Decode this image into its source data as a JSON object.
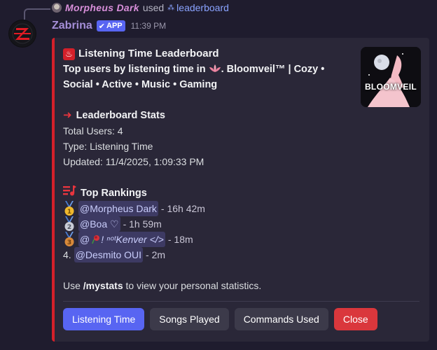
{
  "reply": {
    "user": "Morpheus Dark",
    "used_text": "used",
    "command": "leaderboard"
  },
  "message": {
    "author": "Zabrina",
    "badge": "APP",
    "timestamp": "11:39 PM"
  },
  "embed": {
    "accent_color": "#d4202a",
    "title": "Listening Time Leaderboard",
    "description_line1": "Top users by listening time in",
    "server_name": ". Bloomveil™ | Cozy •",
    "description_line2": "Social • Active • Music • Gaming",
    "thumbnail_text": "BLOOMVEIL",
    "stats": {
      "heading": "Leaderboard Stats",
      "total_users": "Total Users: 4",
      "type": "Type: Listening Time",
      "updated": "Updated: 11/4/2025, 1:09:33 PM"
    },
    "rankings": {
      "heading": "Top Rankings",
      "rows": [
        {
          "medal": "1",
          "user": "@Morpheus Dark",
          "time": " - 16h 42m"
        },
        {
          "medal": "2",
          "user": "@Boa ♡",
          "time": " - 1h 59m"
        },
        {
          "medal": "3",
          "user": "@",
          "user_suffix": "! ⁿᵒᵗKenver </>",
          "time": " - 18m"
        },
        {
          "rank": "4.",
          "user": "@Desmito OUI",
          "time": " - 2m"
        }
      ]
    },
    "footer_prefix": "Use ",
    "footer_command": "/mystats",
    "footer_suffix": " to view your personal statistics."
  },
  "buttons": {
    "listening_time": "Listening Time",
    "songs_played": "Songs Played",
    "commands_used": "Commands Used",
    "close": "Close"
  }
}
